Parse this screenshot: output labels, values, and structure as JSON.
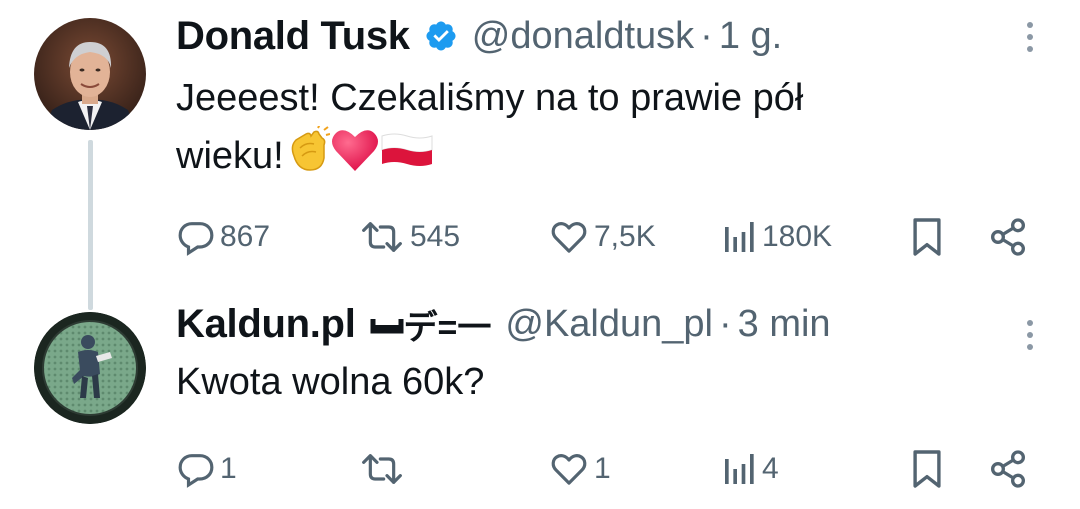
{
  "tweets": [
    {
      "author_name": "Donald Tusk",
      "verified": true,
      "handle": "@donaldtusk",
      "separator": "·",
      "time": "1 g.",
      "text_line1": "Jeeeest! Czekaliśmy na to prawie pół",
      "text_line2": "wieku!",
      "emojis": [
        "clapping-hands",
        "red-heart",
        "flag-poland"
      ],
      "actions": {
        "replies": "867",
        "retweets": "545",
        "likes": "7,5K",
        "views": "180K"
      }
    },
    {
      "author_name": "Kaldun.pl",
      "kaomoji": "デ=一",
      "handle": "@Kaldun_pl",
      "separator": "·",
      "time": "3 min",
      "text": "Kwota wolna 60k?",
      "actions": {
        "replies": "1",
        "retweets": "",
        "likes": "1",
        "views": "4"
      }
    }
  ],
  "colors": {
    "text": "#0f1419",
    "secondary": "#536471",
    "verified": "#1d9bf0",
    "thread_line": "#cfd9de"
  }
}
